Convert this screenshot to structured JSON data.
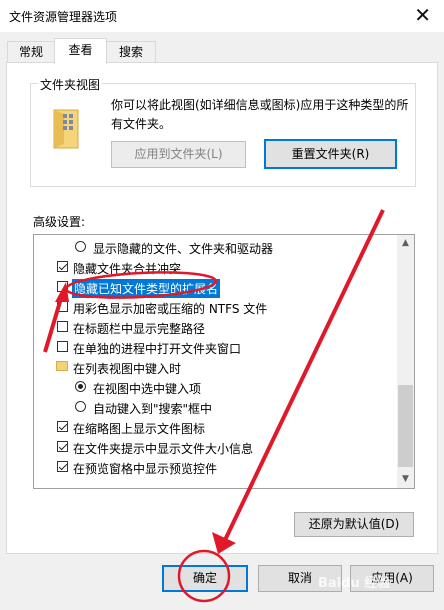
{
  "window": {
    "title": "文件资源管理器选项",
    "close_glyph": "✕"
  },
  "tabs": [
    {
      "label": "常规"
    },
    {
      "label": "查看"
    },
    {
      "label": "搜索"
    }
  ],
  "folder_view": {
    "legend": "文件夹视图",
    "description": "你可以将此视图(如详细信息或图标)应用于这种类型的所有文件夹。",
    "apply_button": "应用到文件夹(L)",
    "reset_button": "重置文件夹(R)"
  },
  "advanced": {
    "label": "高级设置:",
    "items": [
      {
        "type": "radio",
        "checked": false,
        "label": "显示隐藏的文件、文件夹和驱动器"
      },
      {
        "type": "checkbox",
        "checked": true,
        "label": "隐藏文件夹合并冲突"
      },
      {
        "type": "checkbox",
        "checked": false,
        "label": "隐藏已知文件类型的扩展名"
      },
      {
        "type": "checkbox",
        "checked": false,
        "label": "用彩色显示加密或压缩的 NTFS 文件"
      },
      {
        "type": "checkbox",
        "checked": false,
        "label": "在标题栏中显示完整路径"
      },
      {
        "type": "checkbox",
        "checked": false,
        "label": "在单独的进程中打开文件夹窗口"
      },
      {
        "type": "folder",
        "label": "在列表视图中键入时"
      },
      {
        "type": "radio",
        "checked": true,
        "label": "在视图中选中键入项"
      },
      {
        "type": "radio",
        "checked": false,
        "label": "自动键入到\"搜索\"框中"
      },
      {
        "type": "checkbox",
        "checked": true,
        "label": "在缩略图上显示文件图标"
      },
      {
        "type": "checkbox",
        "checked": true,
        "label": "在文件夹提示中显示文件大小信息"
      },
      {
        "type": "checkbox",
        "checked": true,
        "label": "在预览窗格中显示预览控件"
      }
    ],
    "restore_button": "还原为默认值(D)"
  },
  "footer": {
    "ok": "确定",
    "cancel": "取消",
    "apply": "应用(A)"
  },
  "watermark": "Baidu 经验",
  "colors": {
    "annotation": "#e0192a",
    "focus": "#0078d7",
    "highlight_bg": "#0078d7"
  }
}
